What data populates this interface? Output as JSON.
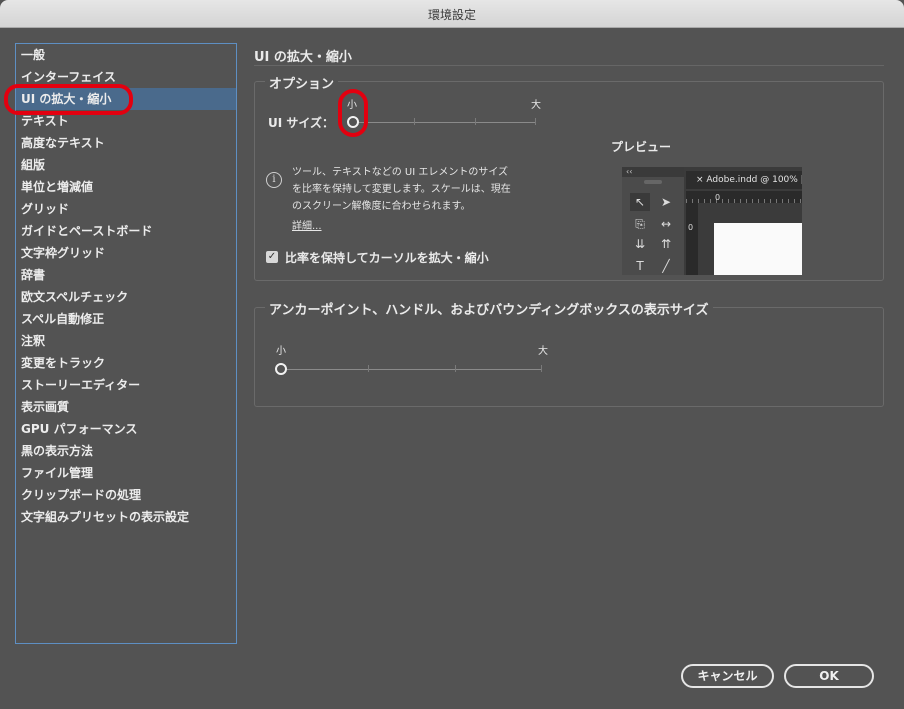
{
  "window": {
    "title": "環境設定"
  },
  "sidebar": {
    "selected_index": 2,
    "items": [
      {
        "label": "一般"
      },
      {
        "label": "インターフェイス"
      },
      {
        "label": "UI の拡大・縮小"
      },
      {
        "label": "テキスト"
      },
      {
        "label": "高度なテキスト"
      },
      {
        "label": "組版"
      },
      {
        "label": "単位と増減値"
      },
      {
        "label": "グリッド"
      },
      {
        "label": "ガイドとペーストボード"
      },
      {
        "label": "文字枠グリッド"
      },
      {
        "label": "辞書"
      },
      {
        "label": "欧文スペルチェック"
      },
      {
        "label": "スペル自動修正"
      },
      {
        "label": "注釈"
      },
      {
        "label": "変更をトラック"
      },
      {
        "label": "ストーリーエディター"
      },
      {
        "label": "表示画質"
      },
      {
        "label": "GPU パフォーマンス"
      },
      {
        "label": "黒の表示方法"
      },
      {
        "label": "ファイル管理"
      },
      {
        "label": "クリップボードの処理"
      },
      {
        "label": "文字組みプリセットの表示設定"
      }
    ]
  },
  "main": {
    "title": "UI の拡大・縮小",
    "options": {
      "legend": "オプション",
      "ui_size_label": "UI サイズ：",
      "slider_min": "小",
      "slider_max": "大",
      "slider_value": 0,
      "info_text": [
        "ツール、テキストなどの UI エレメントのサイズ",
        "を比率を保持して変更します。スケールは、現在",
        "のスクリーン解像度に合わせられます。"
      ],
      "details_link": "詳細...",
      "scale_cursor_checked": true,
      "scale_cursor_label": "比率を保持してカーソルを拡大・縮小",
      "preview_label": "プレビュー",
      "preview": {
        "panel_collapse": "‹‹",
        "doc_tab": "Adobe.indd @ 100% |",
        "ruler_zero_h": "0",
        "ruler_zero_v": "0"
      }
    },
    "anchor": {
      "legend": "アンカーポイント、ハンドル、およびバウンディングボックスの表示サイズ",
      "slider_min": "小",
      "slider_max": "大",
      "slider_value": 0
    }
  },
  "buttons": {
    "cancel": "キャンセル",
    "ok": "OK"
  },
  "colors": {
    "background": "#535353",
    "selection": "#4a6a8c",
    "highlight_mark": "#e3000f",
    "focus_border": "#5e8fc3"
  }
}
